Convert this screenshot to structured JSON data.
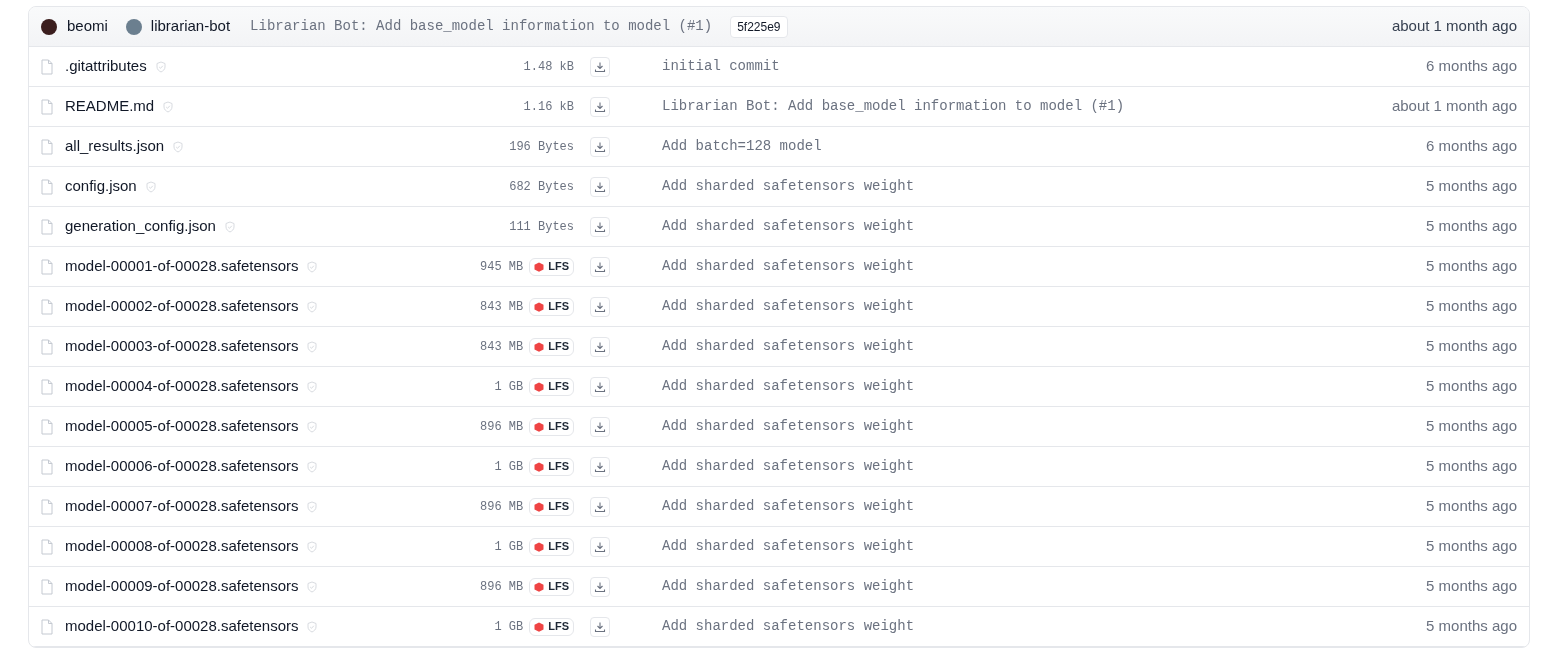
{
  "last_commit": {
    "author": "beomi",
    "coauthor": "librarian-bot",
    "message": "Librarian Bot: Add base_model information to model (#1)",
    "hash": "5f225e9",
    "date": "about 1 month ago"
  },
  "files": [
    {
      "name": ".gitattributes",
      "size": "1.48 kB",
      "lfs": false,
      "commit": "initial commit",
      "date": "6 months ago"
    },
    {
      "name": "README.md",
      "size": "1.16 kB",
      "lfs": false,
      "commit": "Librarian Bot: Add base_model information to model (#1)",
      "date": "about 1 month ago"
    },
    {
      "name": "all_results.json",
      "size": "196 Bytes",
      "lfs": false,
      "commit": "Add batch=128 model",
      "date": "6 months ago"
    },
    {
      "name": "config.json",
      "size": "682 Bytes",
      "lfs": false,
      "commit": "Add sharded safetensors weight",
      "date": "5 months ago"
    },
    {
      "name": "generation_config.json",
      "size": "111 Bytes",
      "lfs": false,
      "commit": "Add sharded safetensors weight",
      "date": "5 months ago"
    },
    {
      "name": "model-00001-of-00028.safetensors",
      "size": "945 MB",
      "lfs": true,
      "lfs_label": "LFS",
      "commit": "Add sharded safetensors weight",
      "date": "5 months ago"
    },
    {
      "name": "model-00002-of-00028.safetensors",
      "size": "843 MB",
      "lfs": true,
      "lfs_label": "LFS",
      "commit": "Add sharded safetensors weight",
      "date": "5 months ago"
    },
    {
      "name": "model-00003-of-00028.safetensors",
      "size": "843 MB",
      "lfs": true,
      "lfs_label": "LFS",
      "commit": "Add sharded safetensors weight",
      "date": "5 months ago"
    },
    {
      "name": "model-00004-of-00028.safetensors",
      "size": "1 GB",
      "lfs": true,
      "lfs_label": "LFS",
      "commit": "Add sharded safetensors weight",
      "date": "5 months ago"
    },
    {
      "name": "model-00005-of-00028.safetensors",
      "size": "896 MB",
      "lfs": true,
      "lfs_label": "LFS",
      "commit": "Add sharded safetensors weight",
      "date": "5 months ago"
    },
    {
      "name": "model-00006-of-00028.safetensors",
      "size": "1 GB",
      "lfs": true,
      "lfs_label": "LFS",
      "commit": "Add sharded safetensors weight",
      "date": "5 months ago"
    },
    {
      "name": "model-00007-of-00028.safetensors",
      "size": "896 MB",
      "lfs": true,
      "lfs_label": "LFS",
      "commit": "Add sharded safetensors weight",
      "date": "5 months ago"
    },
    {
      "name": "model-00008-of-00028.safetensors",
      "size": "1 GB",
      "lfs": true,
      "lfs_label": "LFS",
      "commit": "Add sharded safetensors weight",
      "date": "5 months ago"
    },
    {
      "name": "model-00009-of-00028.safetensors",
      "size": "896 MB",
      "lfs": true,
      "lfs_label": "LFS",
      "commit": "Add sharded safetensors weight",
      "date": "5 months ago"
    },
    {
      "name": "model-00010-of-00028.safetensors",
      "size": "1 GB",
      "lfs": true,
      "lfs_label": "LFS",
      "commit": "Add sharded safetensors weight",
      "date": "5 months ago"
    }
  ]
}
